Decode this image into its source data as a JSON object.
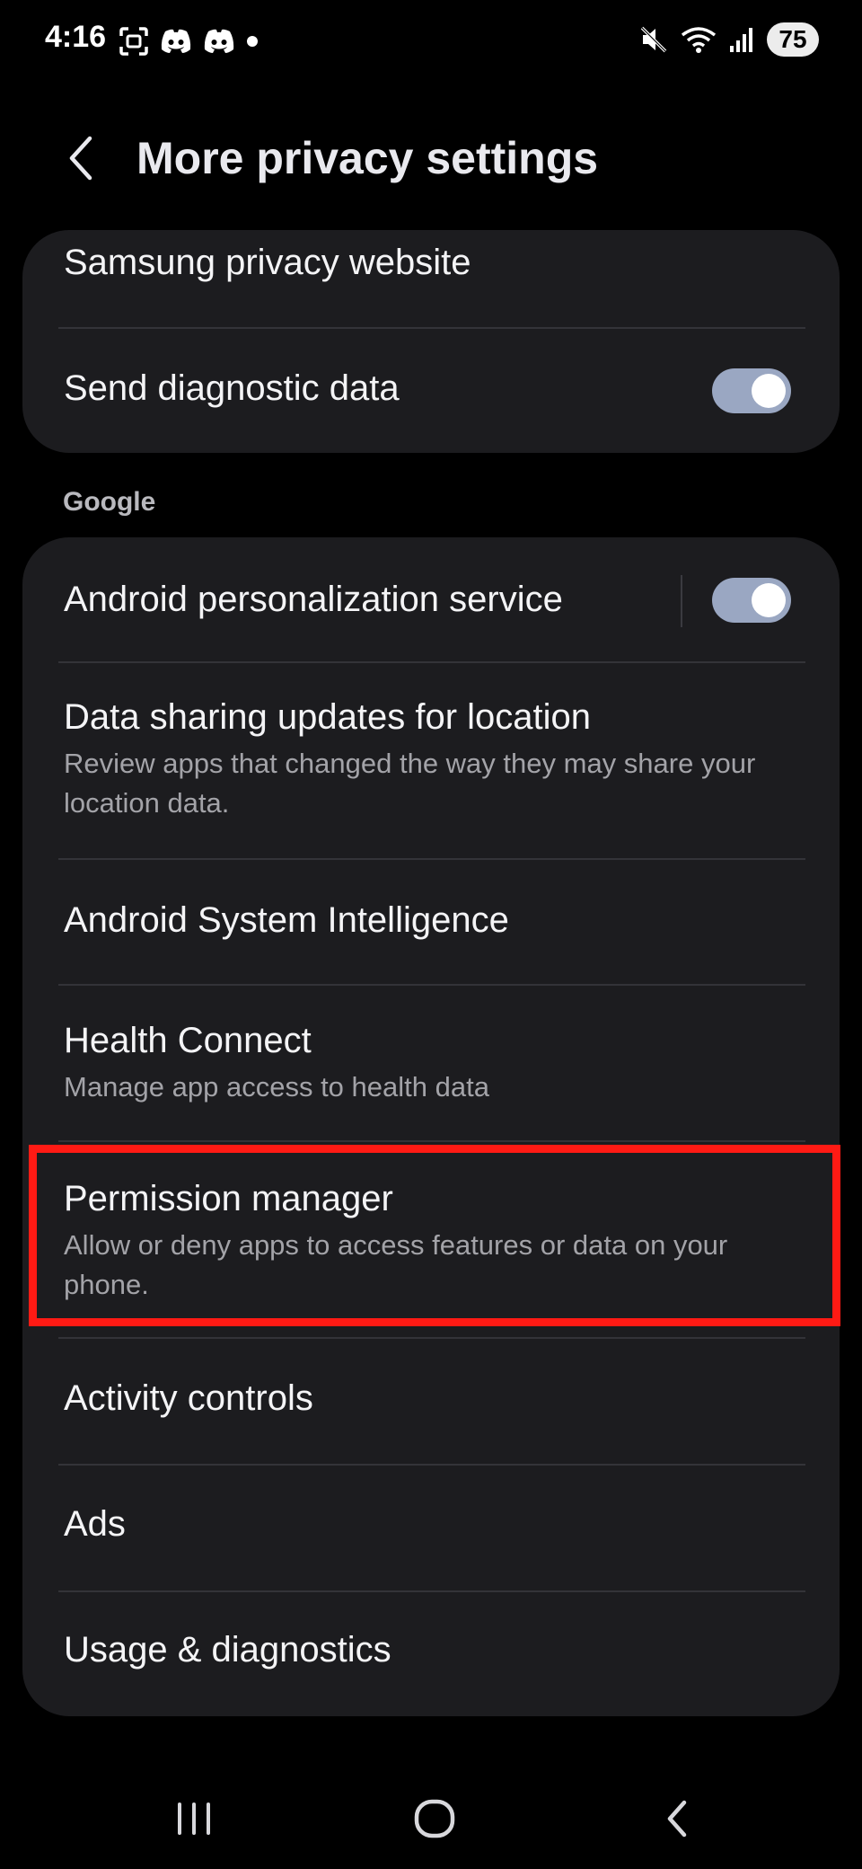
{
  "status_bar": {
    "time": "4:16",
    "left_icons": [
      "screenshot-icon",
      "discord-icon",
      "discord-icon",
      "notification-dot-icon"
    ],
    "right_icons": [
      "mute-icon",
      "wifi-icon",
      "signal-icon"
    ],
    "battery": "75"
  },
  "header": {
    "title": "More privacy settings",
    "back_icon": "chevron-left-icon"
  },
  "card_top": {
    "items": [
      {
        "title": "Samsung privacy website"
      },
      {
        "title": "Send diagnostic data",
        "toggle_on": true
      }
    ]
  },
  "section": {
    "google_label": "Google"
  },
  "card_google": {
    "items": [
      {
        "title": "Android personalization service",
        "toggle_on": true
      },
      {
        "title": "Data sharing updates for location",
        "subtitle": "Review apps that changed the way they may share your location data."
      },
      {
        "title": "Android System Intelligence"
      },
      {
        "title": "Health Connect",
        "subtitle": "Manage app access to health data"
      },
      {
        "title": "Permission manager",
        "subtitle": "Allow or deny apps to access features or data on your phone."
      },
      {
        "title": "Activity controls"
      },
      {
        "title": "Ads"
      },
      {
        "title": "Usage & diagnostics"
      }
    ]
  },
  "colors": {
    "background": "#000000",
    "card": "#1c1c1f",
    "toggle_track": "#9aa7c2",
    "highlight": "#ff1a14"
  },
  "nav_bar": {
    "icons": [
      "recents-icon",
      "home-icon",
      "back-icon"
    ]
  }
}
